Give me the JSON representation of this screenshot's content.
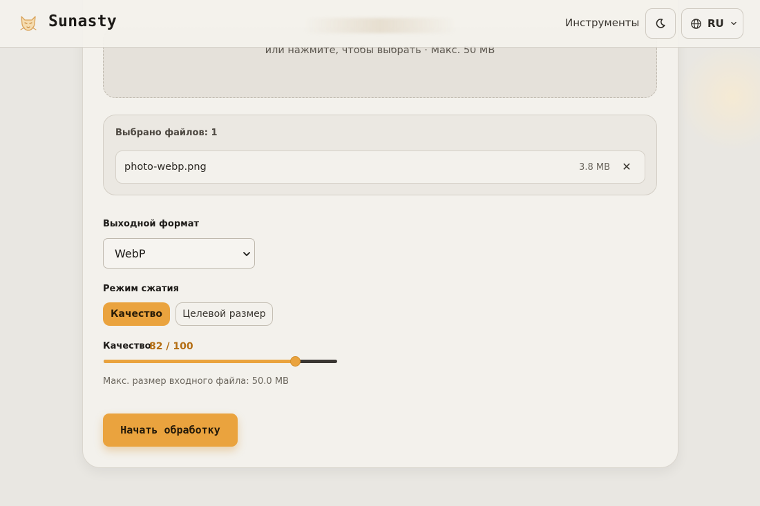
{
  "header": {
    "brand": "Sunasty",
    "nav_tools": "Инструменты",
    "theme_icon": "moon-icon",
    "lang_label": "RU",
    "lang_icon": "globe-icon"
  },
  "upload": {
    "hint": "или нажмите, чтобы выбрать · Макс. 50 MB"
  },
  "files": {
    "count_label": "Выбрано файлов: 1",
    "items": [
      {
        "name": "photo-webp.png",
        "size": "3.8 MB"
      }
    ]
  },
  "output_format": {
    "label": "Выходной формат",
    "selected": "WebP"
  },
  "compression": {
    "label": "Режим сжатия",
    "modes": [
      "Качество",
      "Целевой размер"
    ],
    "active": "Качество"
  },
  "quality": {
    "label": "Качество",
    "value_text": "82 / 100",
    "value": 82,
    "max": 100
  },
  "limits": {
    "max_input": "Макс. размер входного файла: 50.0 MB"
  },
  "actions": {
    "start": "Начать обработку"
  },
  "colors": {
    "accent": "#eaa33e",
    "background": "#e9e7e2",
    "card": "#f3f1ec"
  }
}
